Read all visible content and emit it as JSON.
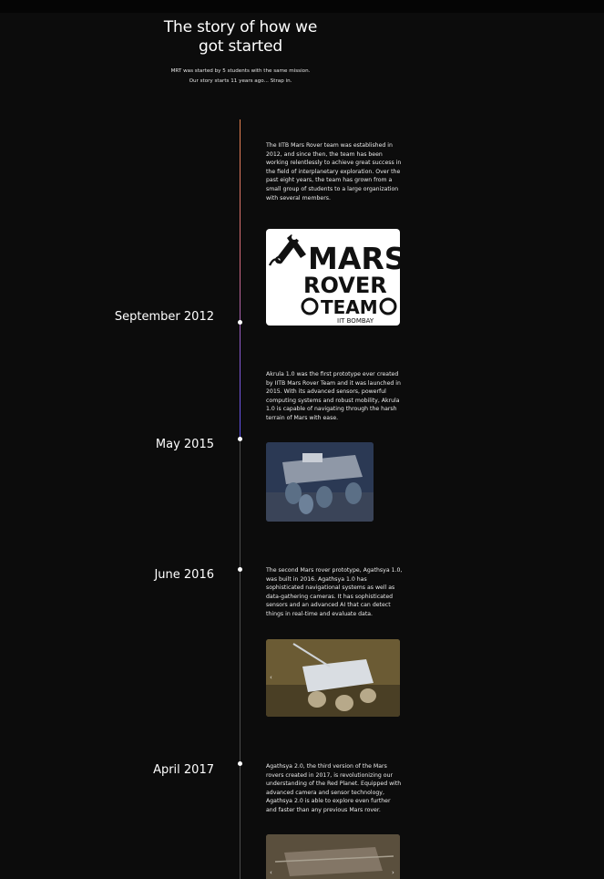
{
  "hero": {
    "title": "The story of how we got started",
    "subtitle_line1": "MRT was started by 5 students with the same mission.",
    "subtitle_line2": "Our story starts 11 years ago... Strap in."
  },
  "timeline": {
    "intro_text": "The IITB Mars Rover team was established in 2012, and since then, the team has been working relentlessly to achieve great success in the field of interplanetary exploration. Over the past eight years, the team has grown from a small group of students to a large organization with several members.",
    "logo": {
      "line1": "MARS",
      "line2": "ROVER",
      "line3": "TEAM",
      "caption": "IIT BOMBAY"
    },
    "events": [
      {
        "date": "September 2012"
      },
      {
        "date": "May 2015",
        "text": "Akrula 1.0 was the first prototype ever created by IITB Mars Rover Team and it was launched in 2015. With its advanced sensors, powerful computing systems and robust mobility, Akrula 1.0 is capable of navigating through the harsh terrain of Mars with ease."
      },
      {
        "date": "June 2016",
        "text": "The second Mars rover prototype, Agathsya 1.0, was built in 2016. Agathsya 1.0 has sophisticated navigational systems as well as data-gathering cameras. It has sophisticated sensors and an advanced AI that can detect things in real-time and evaluate data."
      },
      {
        "date": "April 2017",
        "text": "Agathsya 2.0, the third version of the Mars rovers created in 2017, is revolutionizing our understanding of the Red Planet. Equipped with advanced camera and sensor technology, Agathsya 2.0 is able to explore even further and faster than any previous Mars rover."
      }
    ],
    "carousel": {
      "prev_glyph": "‹",
      "next_glyph": "›"
    }
  },
  "colors": {
    "background": "#0c0c0c",
    "line_gradient_start": "#e5824e",
    "line_gradient_end": "#5b52f0",
    "line_grey": "#4a4a4a"
  }
}
